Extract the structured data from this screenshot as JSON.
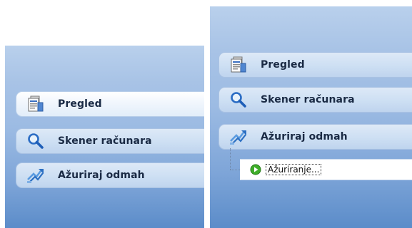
{
  "left_panel": {
    "items": [
      {
        "label": "Pregled",
        "icon": "document-icon",
        "selected": true
      },
      {
        "label": "Skener računara",
        "icon": "magnifier-icon",
        "selected": false
      },
      {
        "label": "Ažuriraj odmah",
        "icon": "update-arrow-icon",
        "selected": false
      }
    ]
  },
  "right_panel": {
    "items": [
      {
        "label": "Pregled",
        "icon": "document-icon",
        "selected": false
      },
      {
        "label": "Skener računara",
        "icon": "magnifier-icon",
        "selected": false
      },
      {
        "label": "Ažuriraj odmah",
        "icon": "update-arrow-icon",
        "selected": false
      }
    ],
    "subitem": {
      "label": "Ažuriranje...",
      "icon": "play-icon"
    }
  },
  "colors": {
    "panel_top": "#b9d0ec",
    "panel_bottom": "#5b8cc9",
    "item_bg": "#cddff3",
    "selected_item_bg": "#f2f7fd",
    "label_text": "#1a2a44",
    "play_green": "#3fae2a"
  }
}
